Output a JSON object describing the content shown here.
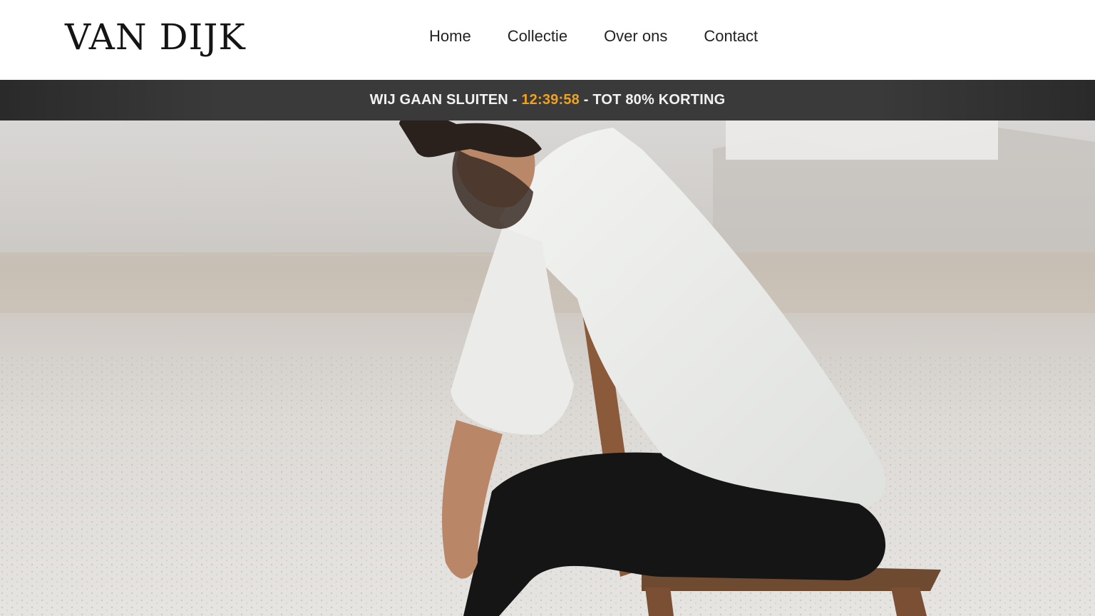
{
  "brand": {
    "logo_text": "VAN DIJK"
  },
  "nav": {
    "items": [
      {
        "label": "Home"
      },
      {
        "label": "Collectie"
      },
      {
        "label": "Over ons"
      },
      {
        "label": "Contact"
      }
    ]
  },
  "announcement": {
    "prefix": "WIJ GAAN SLUITEN - ",
    "timer": "12:39:58",
    "suffix": " - TOT 80% KORTING",
    "timer_color": "#f0a21e",
    "bar_color": "#333333"
  },
  "hero": {
    "image_subject": "man-in-white-shirt-on-wooden-chair"
  }
}
